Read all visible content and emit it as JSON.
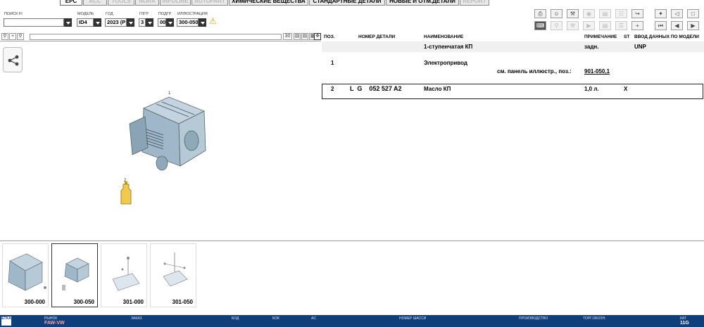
{
  "tabs": [
    {
      "label": "EPC",
      "state": "active"
    },
    {
      "label": "ACC",
      "state": "disabled"
    },
    {
      "label": "TOOLS",
      "state": "disabled"
    },
    {
      "label": "NORA",
      "state": "disabled"
    },
    {
      "label": "INFOLINE",
      "state": "disabled"
    },
    {
      "label": "AUTOPART",
      "state": "disabled"
    },
    {
      "label": "ХИМИЧЕСКИЕ ВЕЩЕСТВА",
      "state": "normal"
    },
    {
      "label": "СТАНДАРТНЫЕ ДЕТАЛИ",
      "state": "normal"
    },
    {
      "label": "НОВЫЕ И ОТМ.ДЕТАЛИ",
      "state": "normal"
    },
    {
      "label": "REPORT",
      "state": "disabled"
    }
  ],
  "filters": {
    "search_label": "ПОИСК FI",
    "search_value": "",
    "model_label": "МОДЕЛЬ",
    "model_value": "ID4",
    "year_label": "ГОД",
    "year_value": "2023 (P",
    "group_label": "ГЛГР",
    "group_value": "3",
    "subgroup_label": "ПОДГР",
    "subgroup_value": "00",
    "illustration_label": "ИЛЛЮСТРАЦИЯ",
    "illustration_value": "300-050",
    "warning_icon": "warning-triangle-icon"
  },
  "illustration": {
    "scale_value": "30",
    "callout_1": "1",
    "callout_2": "2"
  },
  "table": {
    "headers": {
      "pos": "ПОЗ.",
      "part": "НОМЕР ДЕТАЛИ",
      "name": "НАИМЕНОВАНИЕ",
      "note": "ПРИМЕЧАНИЕ",
      "st": "ST",
      "model": "ВВОД ДАННЫХ ПО МОДЕЛИ"
    },
    "rows": [
      {
        "pos": "",
        "part": "",
        "name": "1-ступенчатая КП",
        "note": "задн.",
        "st": "",
        "model": "UNP"
      },
      {
        "pos": "1",
        "part": "",
        "name": "Электропривод",
        "note": "",
        "st": "",
        "model": ""
      },
      {
        "pos": "",
        "part": "",
        "name": "см. панель иллюстр., поз.:",
        "note": "901-050,1",
        "st": "",
        "model": ""
      },
      {
        "pos": "2",
        "part": "L  G    052 527 A2",
        "name": "Масло КП",
        "note": "1,0 л.",
        "st": "X",
        "model": ""
      }
    ]
  },
  "thumbnails": [
    {
      "label": "300-000"
    },
    {
      "label": "300-050"
    },
    {
      "label": "301-000"
    },
    {
      "label": "301-050"
    }
  ],
  "status": {
    "logo": "ETKA",
    "market_label": "РЫНОК",
    "market_value": "FAW-VW",
    "order_label": "ЗАКАЗ",
    "order_value": "",
    "vod_label": "БОД",
    "vok_label": "БОК",
    "ac_label": "AC",
    "chassis_label": "НОМЕР ШАССИ",
    "production_label": "ПРОИЗВОДСТВО",
    "trade_label": "ТОРГ.ОБОЗН.",
    "cat_label": "КАТ",
    "cat_value": "11G"
  }
}
